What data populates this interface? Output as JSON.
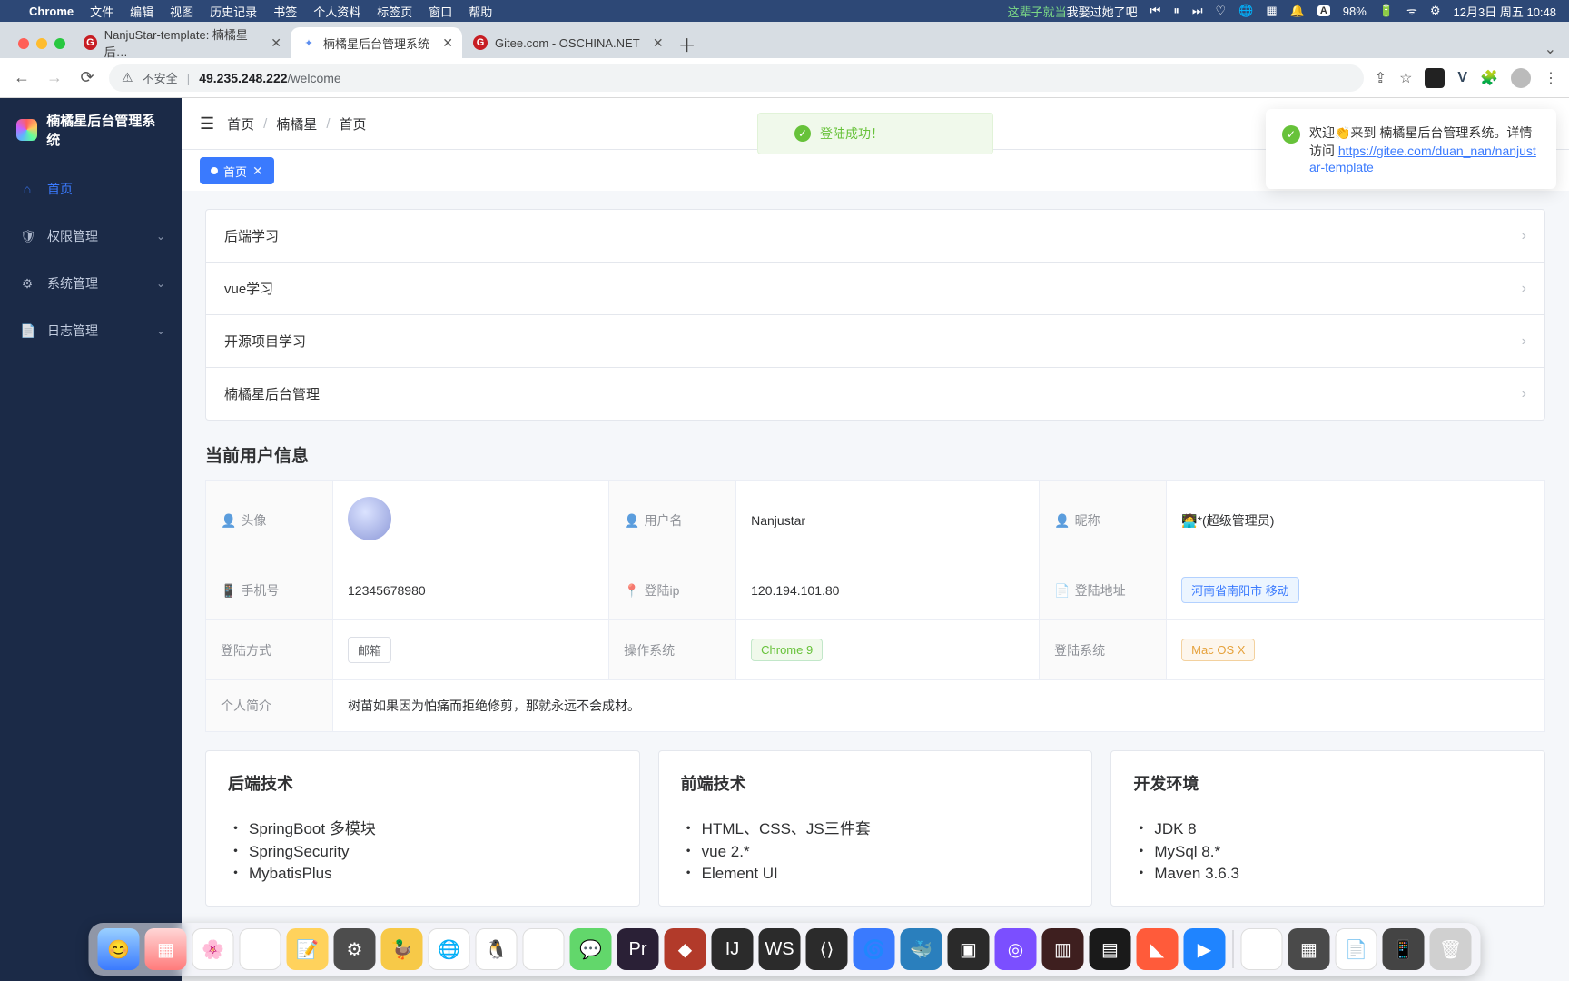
{
  "menubar": {
    "app": "Chrome",
    "items": [
      "文件",
      "编辑",
      "视图",
      "历史记录",
      "书签",
      "个人资料",
      "标签页",
      "窗口",
      "帮助"
    ],
    "lyric_pre": "这辈子就当",
    "lyric_post": "我娶过她了吧",
    "battery": "98%",
    "clock": "12月3日 周五  10:48"
  },
  "tabs": [
    {
      "title": "NanjuStar-template: 楠橘星后…",
      "fav": "g"
    },
    {
      "title": "楠橘星后台管理系统",
      "fav": "n",
      "active": true
    },
    {
      "title": "Gitee.com - OSCHINA.NET",
      "fav": "g"
    }
  ],
  "addressbar": {
    "insecure": "不安全",
    "host": "49.235.248.222",
    "path": "/welcome"
  },
  "sidebar": {
    "brand": "楠橘星后台管理系统",
    "items": [
      {
        "icon": "home",
        "label": "首页",
        "active": true
      },
      {
        "icon": "shield",
        "label": "权限管理",
        "expandable": true
      },
      {
        "icon": "gear",
        "label": "系统管理",
        "expandable": true
      },
      {
        "icon": "log",
        "label": "日志管理",
        "expandable": true
      }
    ]
  },
  "breadcrumb": [
    "首页",
    "楠橘星",
    "首页"
  ],
  "tag": {
    "label": "首页"
  },
  "alert": {
    "text": "登陆成功！"
  },
  "notify": {
    "text_pre": "欢迎👏来到 楠橘星后台管理系统。详情访问",
    "link": "https://gitee.com/duan_nan/nanjustar-template"
  },
  "accordion": [
    "后端学习",
    "vue学习",
    "开源项目学习",
    "楠橘星后台管理"
  ],
  "userinfo": {
    "title": "当前用户信息",
    "labels": {
      "avatar": "头像",
      "username": "用户名",
      "nickname": "昵称",
      "phone": "手机号",
      "loginip": "登陆ip",
      "loginaddr": "登陆地址",
      "loginway": "登陆方式",
      "os": "操作系统",
      "loginsys": "登陆系统",
      "bio": "个人简介"
    },
    "values": {
      "username": "Nanjustar",
      "nickname": "🧑‍💻*(超级管理员)",
      "phone": "12345678980",
      "loginip": "120.194.101.80",
      "loginaddr": "河南省南阳市 移动",
      "loginway": "邮箱",
      "os": "Chrome 9",
      "loginsys": "Mac OS X",
      "bio": "树苗如果因为怕痛而拒绝修剪，那就永远不会成材。"
    }
  },
  "cards": {
    "backend": {
      "title": "后端技术",
      "items": [
        "SpringBoot 多模块",
        "SpringSecurity",
        "MybatisPlus"
      ]
    },
    "frontend": {
      "title": "前端技术",
      "items": [
        "HTML、CSS、JS三件套",
        "vue 2.*",
        "Element UI"
      ]
    },
    "env": {
      "title": "开发环境",
      "items": [
        "JDK 8",
        "MySql 8.*",
        "Maven 3.6.3"
      ]
    }
  }
}
